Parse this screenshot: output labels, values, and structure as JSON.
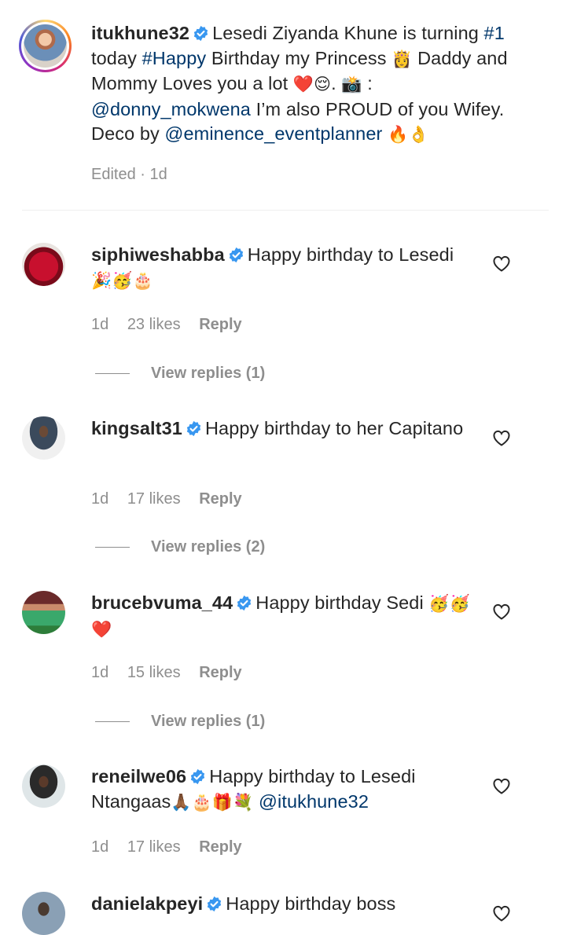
{
  "caption": {
    "username": "itukhune32",
    "text_parts": {
      "p1": "Lesedi Ziyanda Khune is turning ",
      "tag1": "#1",
      "p2": " today ",
      "tag2": "#Happy",
      "p3": " Birthday my Princess ",
      "emoji1": "👸",
      "p4": " Daddy and Mommy Loves you a lot ",
      "emoji2": "❤️😌",
      "p5": ". ",
      "emoji3": "📸",
      "p6": " : ",
      "mention1": "@donny_mokwena",
      "p7": " I’m also PROUD of you Wifey. Deco by ",
      "mention2": "@eminence_eventplanner",
      "p8": " ",
      "emoji4": "🔥👌"
    },
    "meta": "Edited · 1d"
  },
  "comments": [
    {
      "username": "siphiweshabba",
      "text": "Happy birthday to Lesedi",
      "emoji": "🎉🥳🎂",
      "time": "1d",
      "likes": "23 likes",
      "reply": "Reply",
      "view_replies": "View replies (1)"
    },
    {
      "username": "kingsalt31",
      "text": "Happy birthday to her Capitano",
      "emoji": "",
      "time": "1d",
      "likes": "17 likes",
      "reply": "Reply",
      "view_replies": "View replies (2)"
    },
    {
      "username": "brucebvuma_44",
      "text": "Happy birthday Sedi",
      "emoji": "🥳🥳❤️",
      "time": "1d",
      "likes": "15 likes",
      "reply": "Reply",
      "view_replies": "View replies (1)"
    },
    {
      "username": "reneilwe06",
      "text": "Happy birthday to Lesedi Ntangaas",
      "emoji": "🙏🏾🎂🎁💐",
      "mention": "@itukhune32",
      "time": "1d",
      "likes": "17 likes",
      "reply": "Reply"
    },
    {
      "username": "danielakpeyi",
      "text": "Happy birthday boss"
    }
  ],
  "icons": {
    "verified": "verified-badge-icon",
    "like": "heart-outline-icon"
  },
  "colors": {
    "verified_blue": "#3897f0",
    "link": "#00376b",
    "meta_gray": "#8e8e8e",
    "text": "#262626"
  }
}
